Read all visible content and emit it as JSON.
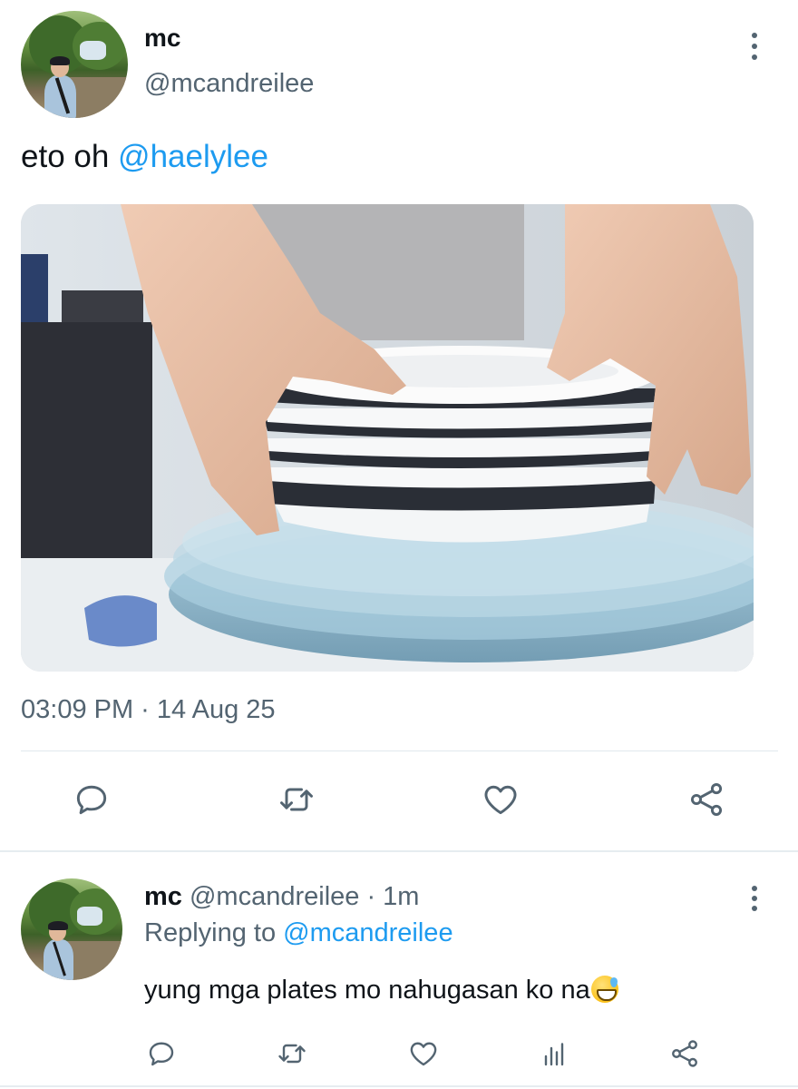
{
  "tweet": {
    "display_name": "mc",
    "handle": "@mcandreilee",
    "text_prefix": "eto oh ",
    "mention": "@haelylee",
    "media_alt": "Person stacking white plates on glass plates",
    "timestamp": "03:09 PM · 14 Aug 25",
    "actions": [
      "reply-icon",
      "retweet-icon",
      "like-icon",
      "share-icon"
    ]
  },
  "reply": {
    "display_name": "mc",
    "handle_time": " @mcandreilee · 1m",
    "replying_label": "Replying to ",
    "replying_to": "@mcandreilee",
    "text": "yung mga plates mo nahugasan ko na",
    "emoji": "grinning-face-with-sweat",
    "actions": [
      "reply-icon",
      "retweet-icon",
      "like-icon",
      "analytics-icon",
      "share-icon"
    ]
  },
  "colors": {
    "link": "#1d9bf0",
    "secondary_text": "#536471",
    "primary_text": "#0f1419",
    "icon": "#536471"
  }
}
